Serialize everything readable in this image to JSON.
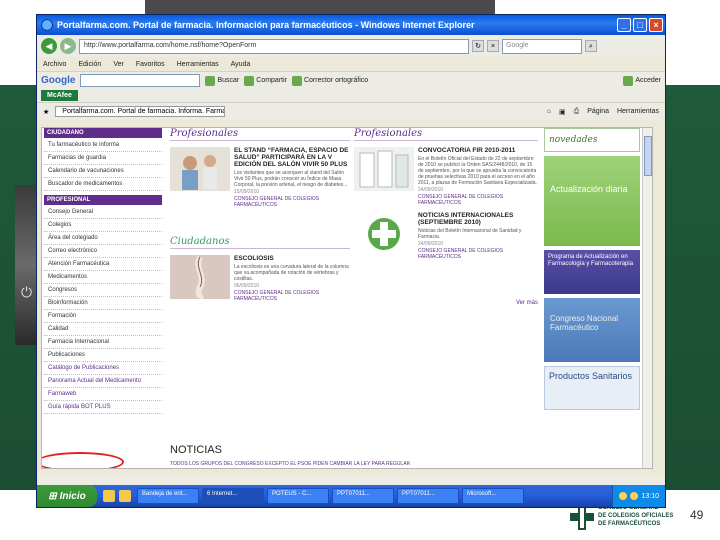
{
  "slide": {
    "page_number": "49"
  },
  "logo": {
    "line1": "CONSEJO GENERAL",
    "line2": "DE COLEGIOS OFICIALES",
    "line3": "DE FARMACÉUTICOS"
  },
  "window": {
    "title": "Portalfarma.com. Portal de farmacia. Información para farmacéuticos - Windows Internet Explorer"
  },
  "address": {
    "url": "http://www.portalfarma.com/home.nsf/home?OpenForm",
    "search_placeholder": "Google"
  },
  "menu": [
    "Archivo",
    "Edición",
    "Ver",
    "Favoritos",
    "Herramientas",
    "Ayuda"
  ],
  "googlebar": {
    "logo": "Google",
    "items": [
      "Buscar",
      "Compartir",
      "Corrector ortográfico",
      "Acceder"
    ]
  },
  "mcafee": "McAfee",
  "tab": {
    "label": "Portalfarma.com. Portal de farmacia. Informa. Farmac..."
  },
  "tabtools": [
    "Página",
    "Herramientas"
  ],
  "sidebar": {
    "head_ciudadano": "CIUDADANO",
    "ciudadano_items": [
      "Tu farmacéutico te informa",
      "Farmacias de guardia",
      "Calendario de vacunaciones",
      "Buscador de medicamentos"
    ],
    "head_profesional": "PROFESIONAL",
    "profesional_items": [
      "Consejo General",
      "Colegios",
      "Área del colegiado",
      "Correo electrónico",
      "Atención Farmacéutica",
      "Medicamentos",
      "Congresos",
      "Bioinformación",
      "Formación",
      "Calidad",
      "Farmacia Internacional",
      "Publicaciones",
      "Catálogo de Publicaciones",
      "Panorama Actual del Medicamento",
      "Farmaweb",
      "Guía rápida BOT PLUS"
    ]
  },
  "profesionales": {
    "title": "Profesionales",
    "article1": {
      "title": "EL STAND “FARMACIA, ESPACIO DE SALUD” PARTICIPARÁ EN LA V EDICIÓN DEL SALÓN VIVIR 50 PLUS",
      "body": "Los visitantes que se acerquen al stand del Salón Vivir 50 Plus, podrán conocer su Índice de Masa Corporal, la presión arterial, el riesgo de diabetes...",
      "date": "15/09/2010",
      "source": "CONSEJO GENERAL DE COLEGIOS FARMACÉUTICOS"
    },
    "article2": {
      "title": "CONVOCATORIA FIR 2010-2011",
      "body": "En el Boletín Oficial del Estado de 22 de septiembre de 2010 se publicó la Orden SAS/2448/2010, de 15 de septiembre, por la que se aprueba la convocatoria de pruebas selectivas 2010 para el acceso en el año 2011, a plazas de Formación Sanitaria Especializada.",
      "date": "24/09/2010",
      "source": "CONSEJO GENERAL DE COLEGIOS FARMACÉUTICOS"
    },
    "article3": {
      "title": "NOTICIAS INTERNACIONALES (SEPTIEMBRE 2010)",
      "body": "Noticias del Boletín Internacional de Sanidad y Farmacia.",
      "date": "24/09/2010",
      "source": "CONSEJO GENERAL DE COLEGIOS FARMACÉUTICOS"
    },
    "vermas": "Ver más"
  },
  "profesionales2": {
    "title": "Profesionales"
  },
  "ciudadanos": {
    "title": "Ciudadanos",
    "article": {
      "title": "ESCOLIOSIS",
      "body": "La escoliosis es una curvatura lateral de la columna que va acompañada de rotación de vértebras y costillas.",
      "date": "06/09/2010",
      "source": "CONSEJO GENERAL DE COLEGIOS FARMACÉUTICOS"
    }
  },
  "noticias": {
    "title": "NOTICIAS",
    "line": "TODOS LOS GRUPOS DEL CONGRESO EXCEPTO EL PSOE PIDEN CAMBIAR LA LEY PARA REGULAR"
  },
  "promos": {
    "novedades": "novedades",
    "actualizacion": "Actualización diaria",
    "farmaco": "Programa de Actualización en Farmacología y Farmacoterapia",
    "congreso": "Congreso Nacional Farmacéutico",
    "productos": "Productos Sanitarios"
  },
  "taskbar": {
    "start": "Inicio",
    "tasks": [
      "Bandeja de ent...",
      "6 Internet...",
      "POTEUS - C...",
      "PPT07011...",
      "PPT07011...",
      "Microsoft..."
    ],
    "clock": "13:10"
  }
}
